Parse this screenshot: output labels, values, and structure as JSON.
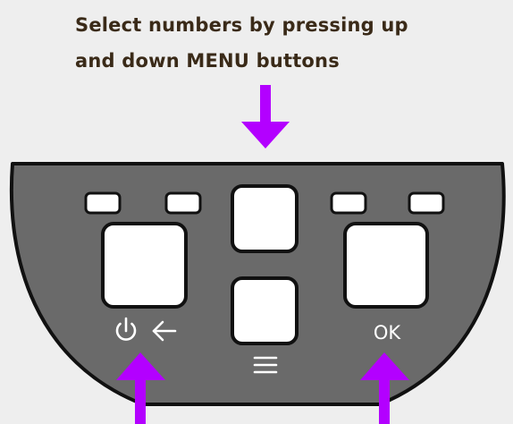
{
  "instruction": {
    "line1": "Select numbers by pressing up",
    "line2": "and down MENU buttons"
  },
  "buttons": {
    "ok_label": "OK"
  },
  "colors": {
    "background": "#eeeeee",
    "device_body": "#6a6a6a",
    "button_fill": "#ffffff",
    "outline": "#111111",
    "arrow": "#b300ff",
    "text": "#3a2a18"
  },
  "icons": {
    "power": "power-icon",
    "back": "back-arrow-icon",
    "menu": "menu-icon"
  }
}
